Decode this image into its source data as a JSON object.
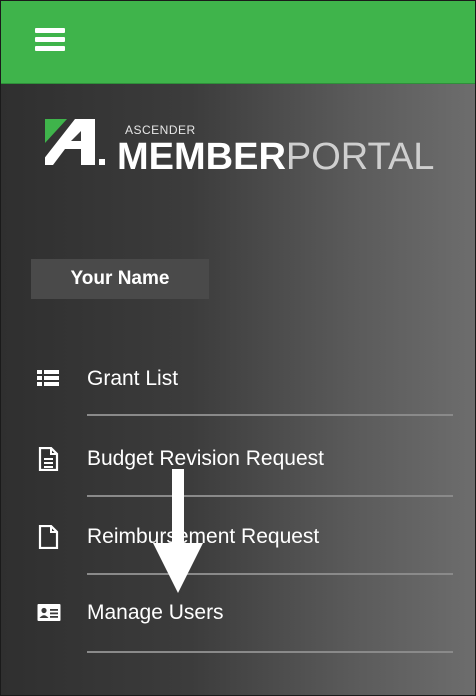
{
  "header": {
    "menu_icon": "hamburger-menu-icon",
    "accent_color": "#3fb44b"
  },
  "logo": {
    "small_text": "ASCENDER",
    "member_text": "MEMBER",
    "portal_text": "PORTAL"
  },
  "user": {
    "name": "Your Name"
  },
  "menu": {
    "items": [
      {
        "label": "Grant List",
        "icon": "list-icon"
      },
      {
        "label": "Budget Revision Request",
        "icon": "document-text-icon"
      },
      {
        "label": "Reimbursement Request",
        "icon": "document-blank-icon"
      },
      {
        "label": "Manage Users",
        "icon": "id-card-icon"
      }
    ]
  },
  "annotation": {
    "arrow_icon": "down-arrow-icon"
  }
}
